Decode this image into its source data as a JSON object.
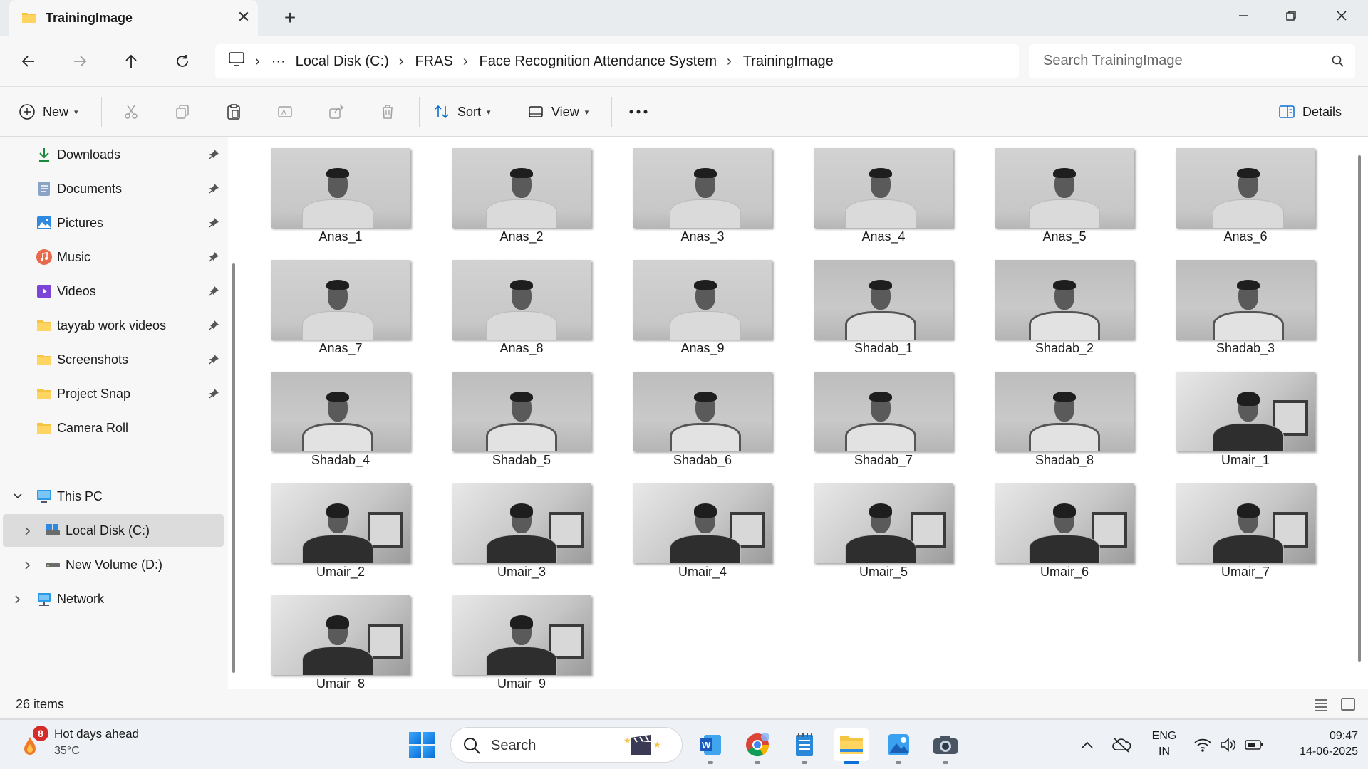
{
  "window": {
    "tab_title": "TrainingImage"
  },
  "address": {
    "crumbs": [
      "Local Disk (C:)",
      "FRAS",
      "Face Recognition Attendance System",
      "TrainingImage"
    ],
    "search_placeholder": "Search TrainingImage"
  },
  "commands": {
    "new_label": "New",
    "sort_label": "Sort",
    "view_label": "View",
    "details_label": "Details"
  },
  "sidebar": {
    "quick_access": [
      {
        "label": "Downloads",
        "icon": "download-icon"
      },
      {
        "label": "Documents",
        "icon": "documents-icon"
      },
      {
        "label": "Pictures",
        "icon": "pictures-icon"
      },
      {
        "label": "Music",
        "icon": "music-icon"
      },
      {
        "label": "Videos",
        "icon": "videos-icon"
      },
      {
        "label": "tayyab work videos",
        "icon": "folder-icon"
      },
      {
        "label": "Screenshots",
        "icon": "folder-icon"
      },
      {
        "label": "Project Snap",
        "icon": "folder-icon"
      },
      {
        "label": "Camera Roll",
        "icon": "folder-icon"
      }
    ],
    "this_pc": "This PC",
    "local_disk": "Local Disk (C:)",
    "new_volume": "New Volume (D:)",
    "network": "Network"
  },
  "files": [
    "Anas_1",
    "Anas_2",
    "Anas_3",
    "Anas_4",
    "Anas_5",
    "Anas_6",
    "Anas_7",
    "Anas_8",
    "Anas_9",
    "Shadab_1",
    "Shadab_2",
    "Shadab_3",
    "Shadab_4",
    "Shadab_5",
    "Shadab_6",
    "Shadab_7",
    "Shadab_8",
    "Umair_1",
    "Umair_2",
    "Umair_3",
    "Umair_4",
    "Umair_5",
    "Umair_6",
    "Umair_7",
    "Umair_8",
    "Umair_9"
  ],
  "status": {
    "item_count": "26 items"
  },
  "taskbar": {
    "weather_badge": "8",
    "weather_text": "Hot days ahead",
    "weather_temp": "35°C",
    "search_label": "Search",
    "lang_top": "ENG",
    "lang_bottom": "IN",
    "time": "09:47",
    "date": "14-06-2025"
  },
  "colors": {
    "accent": "#0b6fd6",
    "folder": "#f4c542",
    "selected_nav": "#dcdcdc"
  }
}
